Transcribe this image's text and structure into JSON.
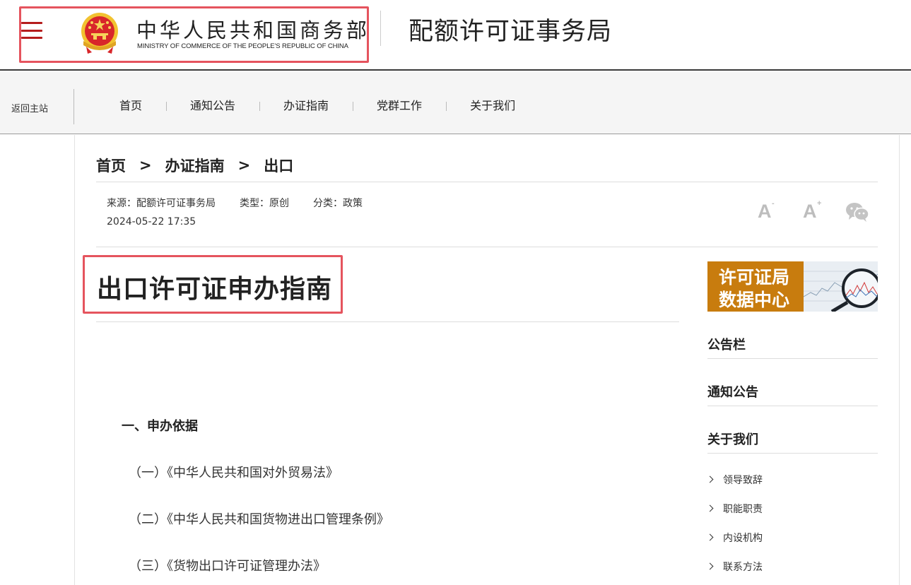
{
  "header": {
    "ministry_cn": "中华人民共和国商务部",
    "ministry_en": "MINISTRY OF COMMERCE OF THE PEOPLE'S REPUBLIC OF CHINA",
    "bureau_title": "配额许可证事务局"
  },
  "nav": {
    "back_home": "返回主站",
    "items": [
      "首页",
      "通知公告",
      "办证指南",
      "党群工作",
      "关于我们"
    ]
  },
  "breadcrumb": [
    "首页",
    "办证指南",
    "出口"
  ],
  "breadcrumb_sep": ">",
  "meta": {
    "source": "来源：配额许可证事务局",
    "type": "类型：原创",
    "category": "分类：政策",
    "date": "2024-05-22 17:35"
  },
  "tools": {
    "font_small": "A",
    "font_small_sup": "-",
    "font_large": "A",
    "font_large_sup": "+",
    "share_icon": "wechat-icon"
  },
  "article": {
    "title": "出口许可证申办指南",
    "section_1": "一、申办依据",
    "clauses": [
      "（一）《中华人民共和国对外贸易法》",
      "（二）《中华人民共和国货物进出口管理条例》",
      "（三）《货物出口许可证管理办法》"
    ]
  },
  "sidebar": {
    "banner_line1": "许可证局",
    "banner_line2": "数据中心",
    "headings": [
      "公告栏",
      "通知公告",
      "关于我们"
    ],
    "about_items": [
      "领导致辞",
      "职能职责",
      "内设机构",
      "联系方法"
    ]
  },
  "colors": {
    "highlight_border": "#e5545e",
    "hamburger": "#b51d1d",
    "banner_bg": "#c87c0e",
    "tool_grey": "#bdbdbd"
  }
}
